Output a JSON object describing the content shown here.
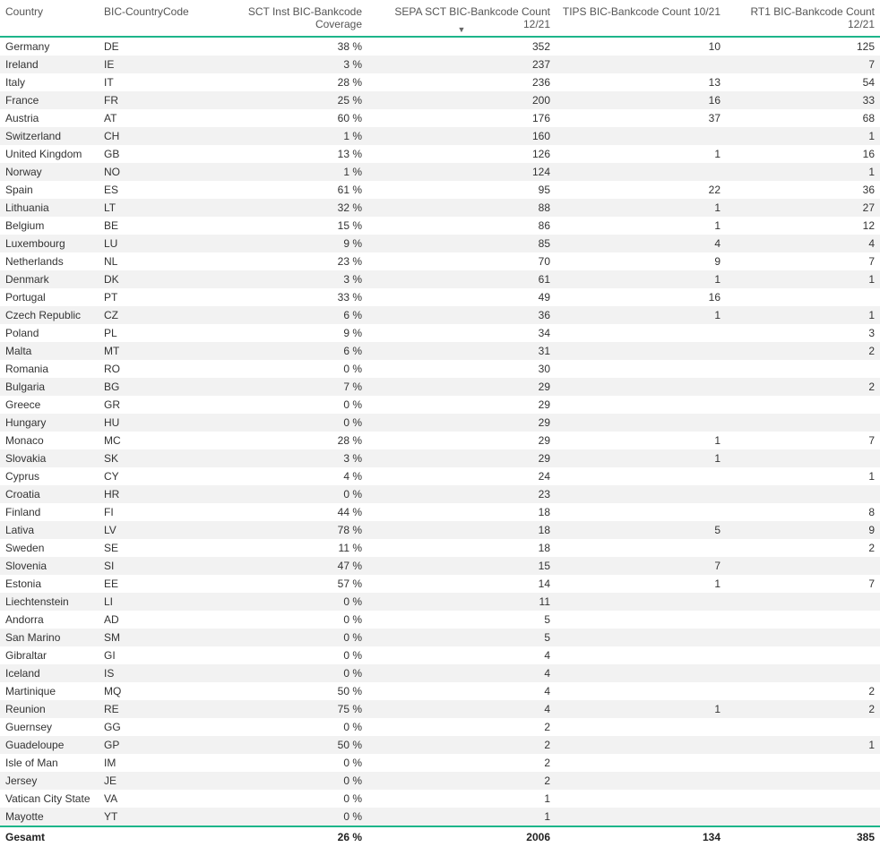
{
  "headers": {
    "country": "Country",
    "bic": "BIC-CountryCode",
    "coverage": "SCT Inst BIC-Bankcode Coverage",
    "sepa": "SEPA SCT BIC-Bankcode Count 12/21",
    "tips": "TIPS BIC-Bankcode Count 10/21",
    "rt1": "RT1 BIC-Bankcode Count 12/21",
    "sort_indicator": "▼"
  },
  "rows": [
    {
      "country": "Germany",
      "bic": "DE",
      "coverage": "38 %",
      "sepa": "352",
      "tips": "10",
      "rt1": "125"
    },
    {
      "country": "Ireland",
      "bic": "IE",
      "coverage": "3 %",
      "sepa": "237",
      "tips": "",
      "rt1": "7"
    },
    {
      "country": "Italy",
      "bic": "IT",
      "coverage": "28 %",
      "sepa": "236",
      "tips": "13",
      "rt1": "54"
    },
    {
      "country": "France",
      "bic": "FR",
      "coverage": "25 %",
      "sepa": "200",
      "tips": "16",
      "rt1": "33"
    },
    {
      "country": "Austria",
      "bic": "AT",
      "coverage": "60 %",
      "sepa": "176",
      "tips": "37",
      "rt1": "68"
    },
    {
      "country": "Switzerland",
      "bic": "CH",
      "coverage": "1 %",
      "sepa": "160",
      "tips": "",
      "rt1": "1"
    },
    {
      "country": "United Kingdom",
      "bic": "GB",
      "coverage": "13 %",
      "sepa": "126",
      "tips": "1",
      "rt1": "16"
    },
    {
      "country": "Norway",
      "bic": "NO",
      "coverage": "1 %",
      "sepa": "124",
      "tips": "",
      "rt1": "1"
    },
    {
      "country": "Spain",
      "bic": "ES",
      "coverage": "61 %",
      "sepa": "95",
      "tips": "22",
      "rt1": "36"
    },
    {
      "country": "Lithuania",
      "bic": "LT",
      "coverage": "32 %",
      "sepa": "88",
      "tips": "1",
      "rt1": "27"
    },
    {
      "country": "Belgium",
      "bic": "BE",
      "coverage": "15 %",
      "sepa": "86",
      "tips": "1",
      "rt1": "12"
    },
    {
      "country": "Luxembourg",
      "bic": "LU",
      "coverage": "9 %",
      "sepa": "85",
      "tips": "4",
      "rt1": "4"
    },
    {
      "country": "Netherlands",
      "bic": "NL",
      "coverage": "23 %",
      "sepa": "70",
      "tips": "9",
      "rt1": "7"
    },
    {
      "country": "Denmark",
      "bic": "DK",
      "coverage": "3 %",
      "sepa": "61",
      "tips": "1",
      "rt1": "1"
    },
    {
      "country": "Portugal",
      "bic": "PT",
      "coverage": "33 %",
      "sepa": "49",
      "tips": "16",
      "rt1": ""
    },
    {
      "country": "Czech Republic",
      "bic": "CZ",
      "coverage": "6 %",
      "sepa": "36",
      "tips": "1",
      "rt1": "1"
    },
    {
      "country": "Poland",
      "bic": "PL",
      "coverage": "9 %",
      "sepa": "34",
      "tips": "",
      "rt1": "3"
    },
    {
      "country": "Malta",
      "bic": "MT",
      "coverage": "6 %",
      "sepa": "31",
      "tips": "",
      "rt1": "2"
    },
    {
      "country": "Romania",
      "bic": "RO",
      "coverage": "0 %",
      "sepa": "30",
      "tips": "",
      "rt1": ""
    },
    {
      "country": "Bulgaria",
      "bic": "BG",
      "coverage": "7 %",
      "sepa": "29",
      "tips": "",
      "rt1": "2"
    },
    {
      "country": "Greece",
      "bic": "GR",
      "coverage": "0 %",
      "sepa": "29",
      "tips": "",
      "rt1": ""
    },
    {
      "country": "Hungary",
      "bic": "HU",
      "coverage": "0 %",
      "sepa": "29",
      "tips": "",
      "rt1": ""
    },
    {
      "country": "Monaco",
      "bic": "MC",
      "coverage": "28 %",
      "sepa": "29",
      "tips": "1",
      "rt1": "7"
    },
    {
      "country": "Slovakia",
      "bic": "SK",
      "coverage": "3 %",
      "sepa": "29",
      "tips": "1",
      "rt1": ""
    },
    {
      "country": "Cyprus",
      "bic": "CY",
      "coverage": "4 %",
      "sepa": "24",
      "tips": "",
      "rt1": "1"
    },
    {
      "country": "Croatia",
      "bic": "HR",
      "coverage": "0 %",
      "sepa": "23",
      "tips": "",
      "rt1": ""
    },
    {
      "country": "Finland",
      "bic": "FI",
      "coverage": "44 %",
      "sepa": "18",
      "tips": "",
      "rt1": "8"
    },
    {
      "country": "Lativa",
      "bic": "LV",
      "coverage": "78 %",
      "sepa": "18",
      "tips": "5",
      "rt1": "9"
    },
    {
      "country": "Sweden",
      "bic": "SE",
      "coverage": "11 %",
      "sepa": "18",
      "tips": "",
      "rt1": "2"
    },
    {
      "country": "Slovenia",
      "bic": "SI",
      "coverage": "47 %",
      "sepa": "15",
      "tips": "7",
      "rt1": ""
    },
    {
      "country": "Estonia",
      "bic": "EE",
      "coverage": "57 %",
      "sepa": "14",
      "tips": "1",
      "rt1": "7"
    },
    {
      "country": "Liechtenstein",
      "bic": "LI",
      "coverage": "0 %",
      "sepa": "11",
      "tips": "",
      "rt1": ""
    },
    {
      "country": "Andorra",
      "bic": "AD",
      "coverage": "0 %",
      "sepa": "5",
      "tips": "",
      "rt1": ""
    },
    {
      "country": "San Marino",
      "bic": "SM",
      "coverage": "0 %",
      "sepa": "5",
      "tips": "",
      "rt1": ""
    },
    {
      "country": "Gibraltar",
      "bic": "GI",
      "coverage": "0 %",
      "sepa": "4",
      "tips": "",
      "rt1": ""
    },
    {
      "country": "Iceland",
      "bic": "IS",
      "coverage": "0 %",
      "sepa": "4",
      "tips": "",
      "rt1": ""
    },
    {
      "country": "Martinique",
      "bic": "MQ",
      "coverage": "50 %",
      "sepa": "4",
      "tips": "",
      "rt1": "2"
    },
    {
      "country": "Reunion",
      "bic": "RE",
      "coverage": "75 %",
      "sepa": "4",
      "tips": "1",
      "rt1": "2"
    },
    {
      "country": "Guernsey",
      "bic": "GG",
      "coverage": "0 %",
      "sepa": "2",
      "tips": "",
      "rt1": ""
    },
    {
      "country": "Guadeloupe",
      "bic": "GP",
      "coverage": "50 %",
      "sepa": "2",
      "tips": "",
      "rt1": "1"
    },
    {
      "country": "Isle of Man",
      "bic": "IM",
      "coverage": "0 %",
      "sepa": "2",
      "tips": "",
      "rt1": ""
    },
    {
      "country": "Jersey",
      "bic": "JE",
      "coverage": "0 %",
      "sepa": "2",
      "tips": "",
      "rt1": ""
    },
    {
      "country": "Vatican City State",
      "bic": "VA",
      "coverage": "0 %",
      "sepa": "1",
      "tips": "",
      "rt1": ""
    },
    {
      "country": "Mayotte",
      "bic": "YT",
      "coverage": "0 %",
      "sepa": "1",
      "tips": "",
      "rt1": ""
    }
  ],
  "totals": {
    "label": "Gesamt",
    "coverage": "26 %",
    "sepa": "2006",
    "tips": "134",
    "rt1": "385"
  }
}
